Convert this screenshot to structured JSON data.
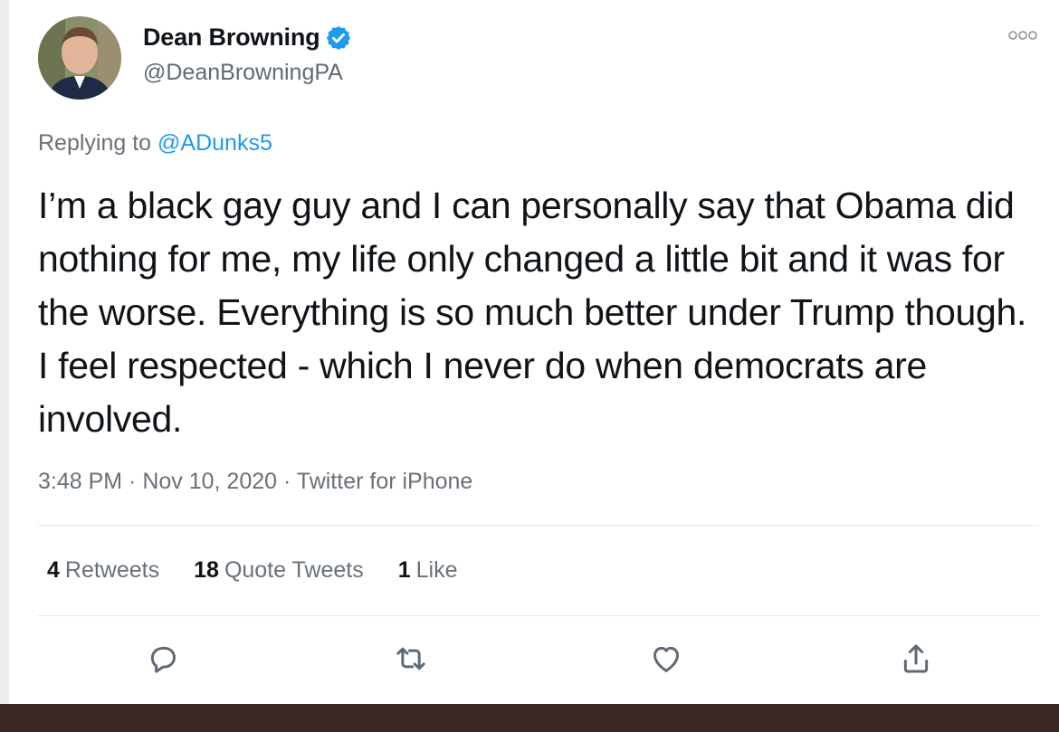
{
  "author": {
    "display_name": "Dean Browning",
    "handle": "@DeanBrowningPA",
    "verified": true
  },
  "reply": {
    "prefix": "Replying to",
    "mention": "@ADunks5"
  },
  "tweet": {
    "text": "I’m a black gay guy and I can personally say that Obama did nothing for me, my life only changed a little bit and it was for the worse. Everything is so much better under Trump though. I feel respected - which I never do when democrats are involved.",
    "meta": "3:48 PM · Nov 10, 2020 · Twitter for iPhone"
  },
  "stats": {
    "retweets_count": "4",
    "retweets_label": "Retweets",
    "quotes_count": "18",
    "quotes_label": "Quote Tweets",
    "likes_count": "1",
    "likes_label": "Like"
  },
  "icons": {
    "more": "more-options-icon",
    "reply": "reply-icon",
    "retweet": "retweet-icon",
    "like": "heart-icon",
    "share": "share-icon",
    "verified": "verified-badge-icon"
  },
  "colors": {
    "accent": "#1d9bf0",
    "text_primary": "#0f1419",
    "text_secondary": "#68717a",
    "icon": "#5f6a74"
  }
}
